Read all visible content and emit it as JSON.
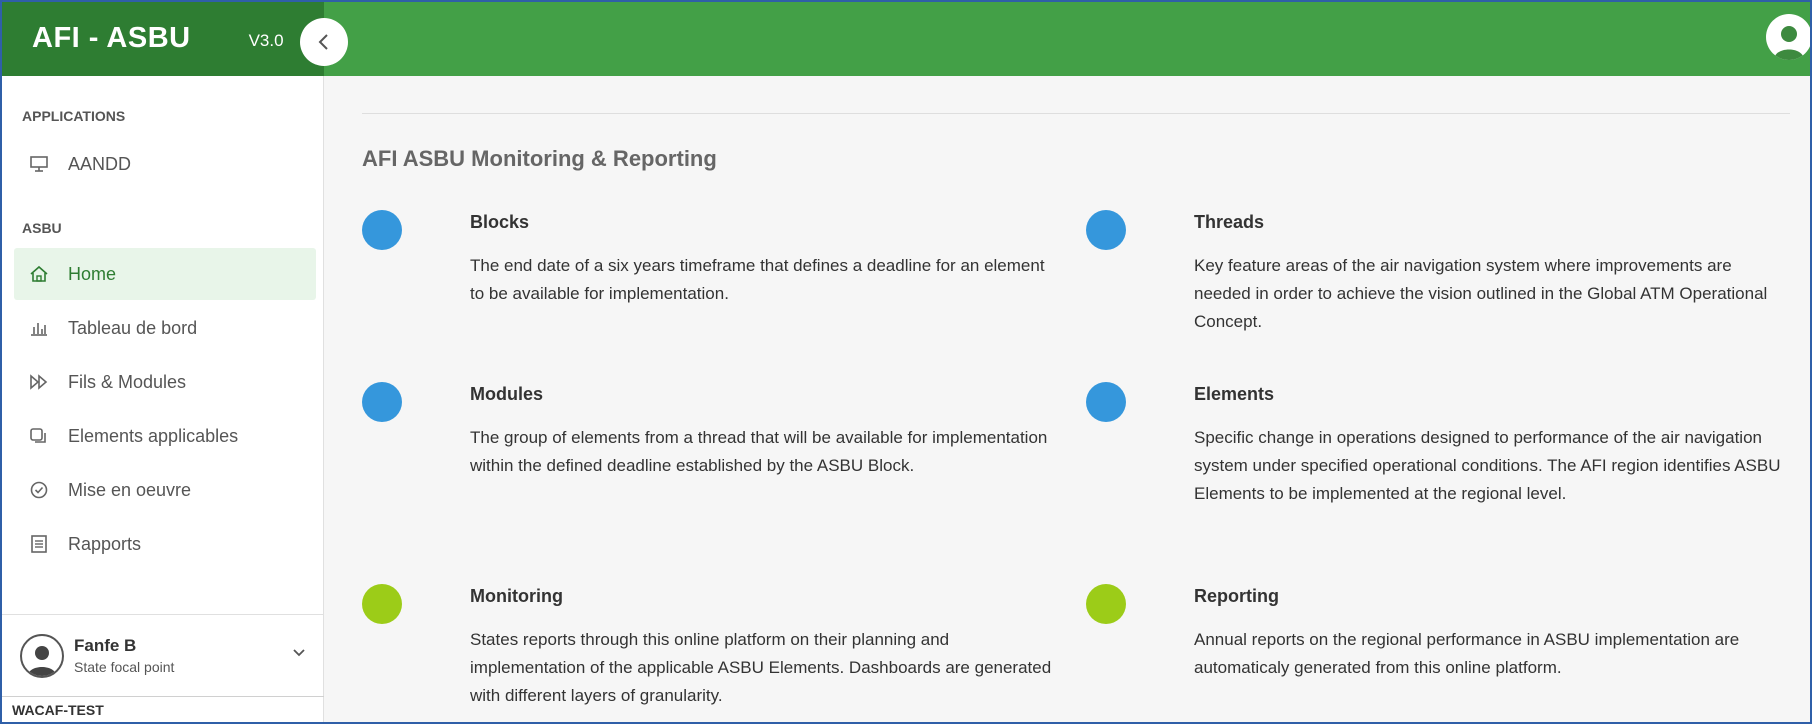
{
  "brand": {
    "title": "AFI - ASBU",
    "version": "V3.0"
  },
  "icons": {
    "collapse": "chevron-left-icon",
    "user": "user-circle-icon"
  },
  "colors": {
    "brand_dark": "#2e7d32",
    "topbar": "#43a047",
    "blue_dot": "#3597dc",
    "green_dot": "#9ccc18",
    "active_bg": "#e8f5e9"
  },
  "sidebar": {
    "section_applications": "APPLICATIONS",
    "app_items": [
      {
        "label": "AANDD",
        "icon": "monitor-icon"
      }
    ],
    "section_asbu": "ASBU",
    "items": [
      {
        "label": "Home",
        "icon": "home-icon",
        "active": true
      },
      {
        "label": "Tableau de bord",
        "icon": "bar-chart-icon"
      },
      {
        "label": "Fils & Modules",
        "icon": "fast-forward-icon"
      },
      {
        "label": "Elements applicables",
        "icon": "copy-icon"
      },
      {
        "label": "Mise en oeuvre",
        "icon": "check-circle-icon"
      },
      {
        "label": "Rapports",
        "icon": "document-icon"
      }
    ],
    "profile": {
      "name": "Fanfe B",
      "role": "State focal point"
    },
    "org": "WACAF-TEST"
  },
  "main": {
    "title": "AFI ASBU Monitoring & Reporting",
    "cards": [
      {
        "title": "Blocks",
        "desc": "The end date of a six years timeframe that defines a deadline for an element to be available for implementation.",
        "color": "blue"
      },
      {
        "title": "Threads",
        "desc": "Key feature areas of the air navigation system where improvements are needed in order to achieve the vision outlined in the Global ATM Operational Concept.",
        "color": "blue"
      },
      {
        "title": "Modules",
        "desc": "The group of elements from a thread that will be available for implementation within the defined deadline established by the ASBU Block.",
        "color": "blue"
      },
      {
        "title": "Elements",
        "desc": "Specific change in operations designed to performance of the air navigation system under specified operational conditions. The AFI region identifies ASBU Elements to be implemented at the regional level.",
        "color": "blue"
      },
      {
        "title": "Monitoring",
        "desc": "States reports through this online platform on their planning and implementation of the applicable ASBU Elements. Dashboards are generated with different layers of granularity.",
        "color": "green"
      },
      {
        "title": "Reporting",
        "desc": "Annual reports on the regional performance in ASBU implementation are automaticaly generated from this online platform.",
        "color": "green"
      }
    ]
  }
}
